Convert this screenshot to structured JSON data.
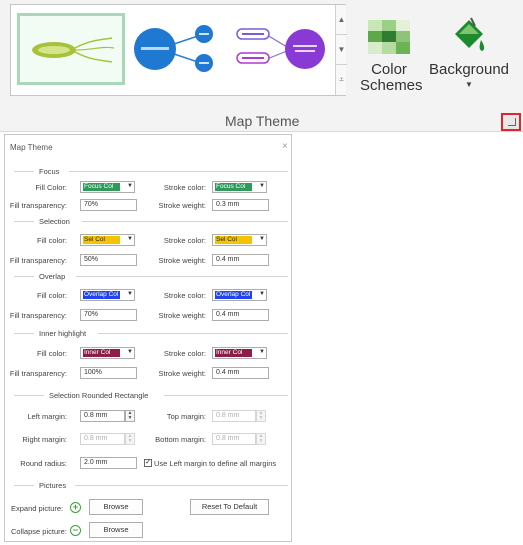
{
  "ribbon": {
    "color_schemes_label": "Color\nSchemes",
    "background_label": "Background",
    "group_label": "Map Theme",
    "launcher_highlight_color": "#e0252b"
  },
  "dialog": {
    "title": "Map Theme",
    "close_glyph": "×",
    "sections": {
      "focus": {
        "heading": "Focus",
        "fill_label": "Fill Color:",
        "fill_value": "Focus Col",
        "fill_color": "#2f9a5a",
        "stroke_label": "Stroke color:",
        "stroke_value": "Focus Col",
        "stroke_color": "#2f9a5a",
        "transparency_label": "Fill transparency:",
        "transparency_value": "70%",
        "weight_label": "Stroke weight:",
        "weight_value": "0.3 mm"
      },
      "selection": {
        "heading": "Selection",
        "fill_label": "Fill color:",
        "fill_value": "Sel Col",
        "fill_color": "#f5c400",
        "stroke_label": "Stroke color:",
        "stroke_value": "Sel Col",
        "stroke_color": "#f5c400",
        "transparency_label": "Fill transparency:",
        "transparency_value": "50%",
        "weight_label": "Stroke weight:",
        "weight_value": "0.4 mm"
      },
      "overlap": {
        "heading": "Overlap",
        "fill_label": "Fill color:",
        "fill_value": "Overlap Col",
        "fill_color": "#2244ee",
        "stroke_label": "Stroke color:",
        "stroke_value": "Overlap Col",
        "stroke_color": "#2244ee",
        "transparency_label": "Fill transparency:",
        "transparency_value": "70%",
        "weight_label": "Stroke weight:",
        "weight_value": "0.4 mm"
      },
      "inner_highlight": {
        "heading": "Inner highlight",
        "fill_label": "Fill color:",
        "fill_value": "Inner Col",
        "fill_color": "#8a1f4a",
        "stroke_label": "Stroke color:",
        "stroke_value": "Inner Col",
        "stroke_color": "#8a1f4a",
        "transparency_label": "Fill transparency:",
        "transparency_value": "100%",
        "weight_label": "Stroke weight:",
        "weight_value": "0.4 mm"
      },
      "rounded": {
        "heading": "Selection Rounded Rectangle",
        "left_label": "Left margin:",
        "left_value": "0.8 mm",
        "top_label": "Top margin:",
        "top_value": "0.8 mm",
        "right_label": "Right margin:",
        "right_value": "0.8 mm",
        "bottom_label": "Bottom margin:",
        "bottom_value": "0.8 mm",
        "radius_label": "Round radius:",
        "radius_value": "2.0 mm",
        "use_left_label": "Use Left margin to define all margins",
        "use_left_checked": true
      },
      "pictures": {
        "heading": "Pictures",
        "expand_label": "Expand picture:",
        "collapse_label": "Collapse picture:",
        "browse_label": "Browse",
        "reset_label": "Reset To Default"
      }
    }
  }
}
